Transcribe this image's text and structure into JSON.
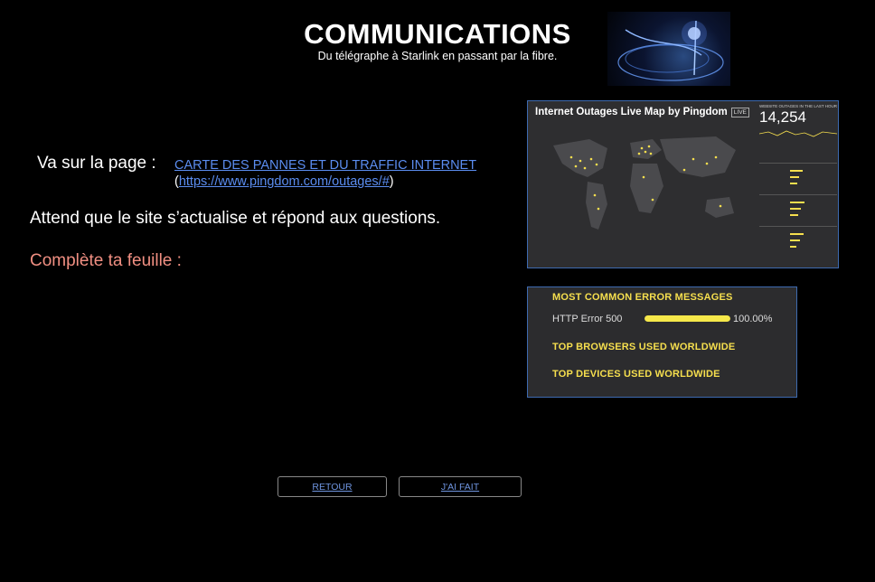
{
  "header": {
    "title": "COMMUNICATIONS",
    "subtitle": "Du télégraphe à Starlink en passant par la fibre."
  },
  "instructions": {
    "va_label": "Va sur la page :",
    "link_text": "CARTE DES PANNES ET DU TRAFFIC INTERNET",
    "link_url": "https://www.pingdom.com/outages/#",
    "paren_open": "(",
    "paren_close": ")",
    "attend": "Attend que le site s’actualise et répond aux questions.",
    "complete": "Complète ta feuille :"
  },
  "map_screenshot": {
    "title": "Internet Outages Live Map by Pingdom",
    "live_badge": "LIVE",
    "stats_heading": "WEBSITE OUTAGES IN THE LAST HOUR",
    "stats_value": "14,254",
    "dot_color": "#f6df4e"
  },
  "errors_panel": {
    "heading_errors": "MOST COMMON ERROR MESSAGES",
    "error_label": "HTTP Error 500",
    "error_percent": "100.00%",
    "error_fraction": 1.0,
    "heading_browsers": "TOP BROWSERS USED WORLDWIDE",
    "heading_devices": "TOP DEVICES USED WORLDWIDE",
    "accent_color": "#f6df4e"
  },
  "nav": {
    "retour_label": "RETOUR",
    "fait_label": "J'AI FAIT"
  }
}
